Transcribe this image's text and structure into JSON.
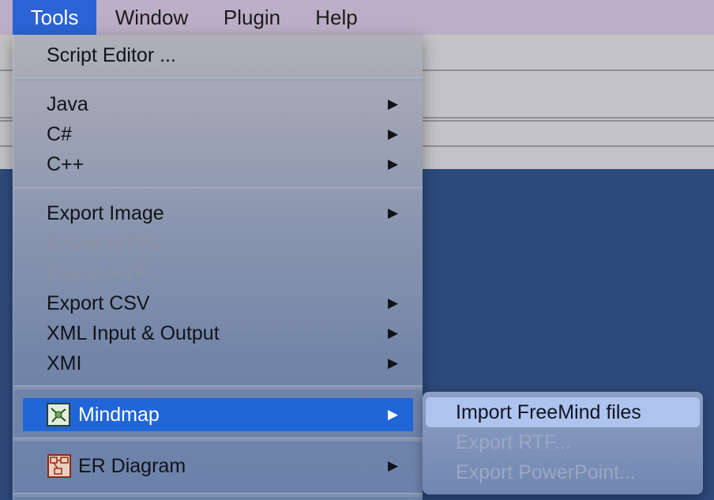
{
  "menubar": {
    "items": [
      {
        "label": "Tools",
        "active": true
      },
      {
        "label": "Window",
        "active": false
      },
      {
        "label": "Plugin",
        "active": false
      },
      {
        "label": "Help",
        "active": false
      }
    ]
  },
  "menu": {
    "script_editor": "Script Editor ...",
    "java": "Java",
    "csharp": "C#",
    "cpp": "C++",
    "export_image": "Export Image",
    "export_html": "Export HTML ...",
    "export_rtf": "Export RTF...",
    "export_csv": "Export CSV",
    "xml_io": "XML Input & Output",
    "xmi": "XMI",
    "mindmap": "Mindmap",
    "er_diagram": "ER Diagram",
    "submenu_arrow": "▶"
  },
  "submenu": {
    "import_freemind": "Import FreeMind files",
    "export_rtf": "Export RTF...",
    "export_powerpoint": "Export PowerPoint..."
  },
  "colors": {
    "accent": "#2166d6",
    "menubar_bg": "#bcaec6",
    "canvas_bg": "#2d4a7c"
  },
  "icons": {
    "mindmap": "mindmap-icon",
    "er_diagram": "er-diagram-icon"
  }
}
